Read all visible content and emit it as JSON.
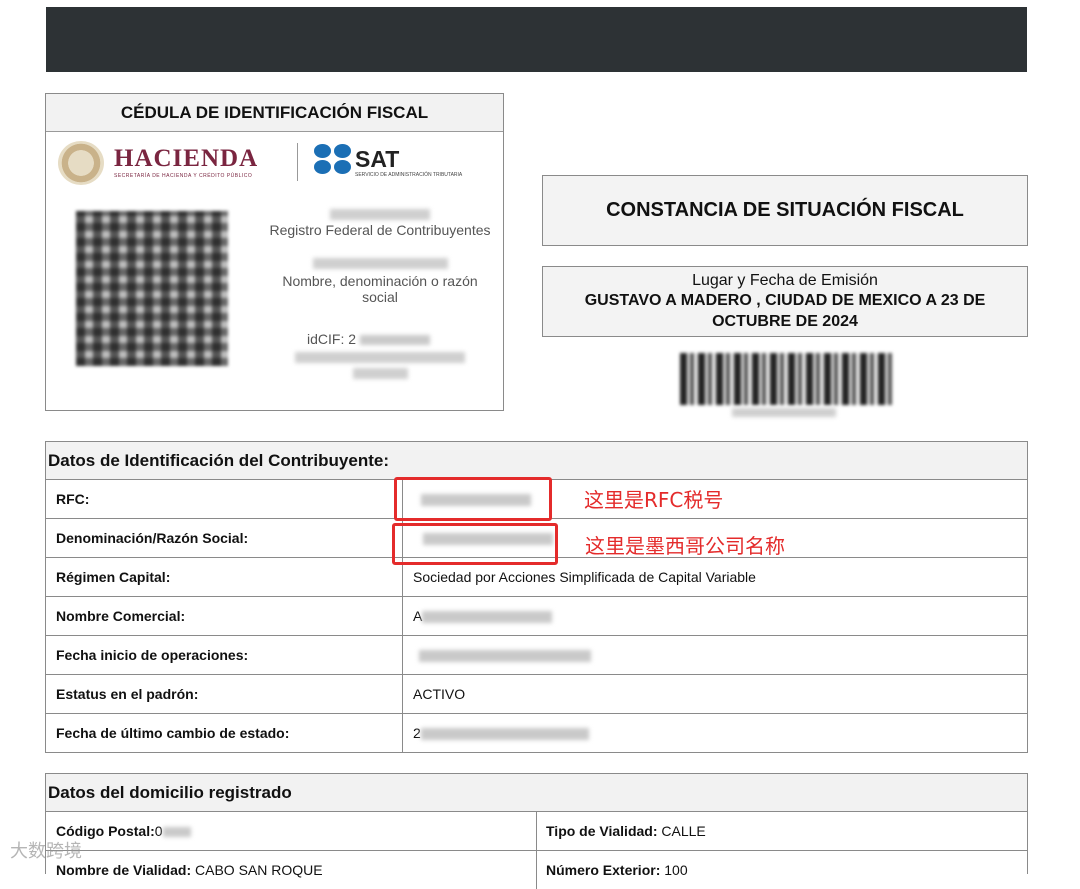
{
  "cedula": {
    "title": "CÉDULA DE IDENTIFICACIÓN FISCAL",
    "hacienda_logo": "HACIENDA",
    "hacienda_sub": "SECRETARÍA DE HACIENDA Y CRÉDITO PÚBLICO",
    "sat_logo": "SAT",
    "sat_sub": "SERVICIO DE ADMINISTRACIÓN TRIBUTARIA",
    "rfc_label": "Registro Federal de Contribuyentes",
    "nombre_label": "Nombre, denominación o razón social",
    "idcif_prefix": "idCIF: 2"
  },
  "constancia_title": "CONSTANCIA DE SITUACIÓN FISCAL",
  "lugar": {
    "label": "Lugar y Fecha de Emisión",
    "value": "GUSTAVO A MADERO , CIUDAD DE MEXICO A 23 DE OCTUBRE DE 2024"
  },
  "identificacion": {
    "title": "Datos de Identificación del Contribuyente:",
    "rows": [
      {
        "label": "RFC:",
        "value": ""
      },
      {
        "label": "Denominación/Razón Social:",
        "value": ""
      },
      {
        "label": "Régimen Capital:",
        "value": "Sociedad por Acciones Simplificada de Capital Variable"
      },
      {
        "label": "Nombre Comercial:",
        "value": "A"
      },
      {
        "label": "Fecha inicio de operaciones:",
        "value": ""
      },
      {
        "label": "Estatus en el padrón:",
        "value": "ACTIVO"
      },
      {
        "label": "Fecha de último cambio de estado:",
        "value": "2"
      }
    ]
  },
  "annotations": {
    "rfc_note": "这里是RFC税号",
    "razon_note": "这里是墨西哥公司名称",
    "color": "#e42b2b"
  },
  "domicilio": {
    "title": "Datos del domicilio registrado",
    "cp_label": "Código Postal:",
    "cp_value": "0",
    "tipo_label": "Tipo de Vialidad:",
    "tipo_value": "CALLE",
    "nombre_label": "Nombre de Vialidad:",
    "nombre_value": "CABO SAN ROQUE",
    "num_label": "Número Exterior:",
    "num_value": "100"
  },
  "watermark": "大数跨境"
}
